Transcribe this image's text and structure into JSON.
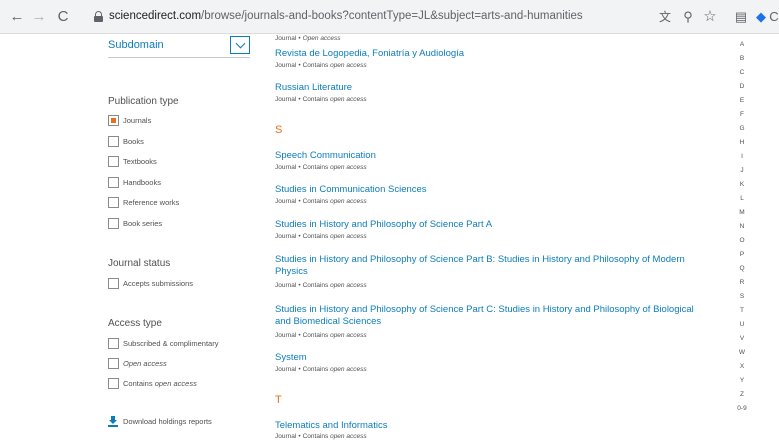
{
  "browser": {
    "url_domain": "sciencedirect.com",
    "url_rest": "/browse/journals-and-books?contentType=JL&subject=arts-and-humanities",
    "back_glyph": "←",
    "forward_glyph": "→",
    "reload_glyph": "C",
    "translate_glyph": "文",
    "zoom_glyph": "⚲",
    "star_glyph": "☆",
    "page_glyph": "▤",
    "ext_glyph": "◆",
    "menu_glyph": "C"
  },
  "sidebar": {
    "subdomain_label": "Subdomain",
    "publication_type": {
      "heading": "Publication type",
      "options": [
        {
          "label": "Journals",
          "checked": true
        },
        {
          "label": "Books",
          "checked": false
        },
        {
          "label": "Textbooks",
          "checked": false
        },
        {
          "label": "Handbooks",
          "checked": false
        },
        {
          "label": "Reference works",
          "checked": false
        },
        {
          "label": "Book series",
          "checked": false
        }
      ]
    },
    "journal_status": {
      "heading": "Journal status",
      "options": [
        {
          "label": "Accepts submissions",
          "checked": false
        }
      ]
    },
    "access_type": {
      "heading": "Access type",
      "options": [
        {
          "label": "Subscribed & complimentary",
          "checked": false
        },
        {
          "label_italic": "Open access",
          "checked": false
        },
        {
          "label_prefix": "Contains",
          "label_italic": "open access",
          "checked": false
        }
      ]
    },
    "download_label": "Download holdings reports"
  },
  "journals": {
    "meta_type": "Journal",
    "meta_bullet": "•",
    "meta_contains": "Contains",
    "meta_open_access": "open access",
    "meta_open_access_cap": "Open access",
    "partial_top": {
      "meta": "Open access"
    },
    "items": [
      {
        "title": "Revista de Logopedia, Foniatría y Audiología"
      },
      {
        "title": "Russian Literature"
      },
      {
        "title": "Speech Communication"
      },
      {
        "title": "Studies in Communication Sciences"
      },
      {
        "title": "Studies in History and Philosophy of Science Part A"
      },
      {
        "title": "Studies in History and Philosophy of Science Part B: Studies in History and Philosophy of Modern Physics"
      },
      {
        "title": "Studies in History and Philosophy of Science Part C: Studies in History and Philosophy of Biological and Biomedical Sciences"
      },
      {
        "title": "System"
      },
      {
        "title": "Telematics and Informatics"
      }
    ],
    "letter_s": "S",
    "letter_t": "T"
  },
  "alphabet": [
    "A",
    "B",
    "C",
    "D",
    "E",
    "F",
    "G",
    "H",
    "I",
    "J",
    "K",
    "L",
    "M",
    "N",
    "O",
    "P",
    "Q",
    "R",
    "S",
    "T",
    "U",
    "V",
    "W",
    "X",
    "Y",
    "Z",
    "0-9"
  ],
  "colors": {
    "link": "#0c7dbb",
    "accent": "#e9711c",
    "text": "#505050"
  }
}
